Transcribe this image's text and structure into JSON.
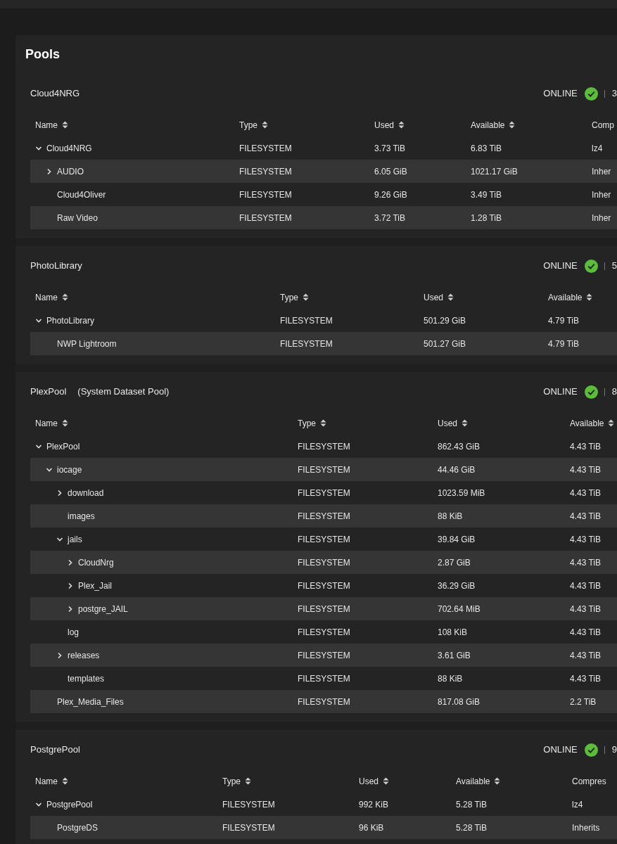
{
  "card_title": "Pools",
  "pools": [
    {
      "name": "Cloud4NRG",
      "status": "ONLINE",
      "healthy": true,
      "summary": "3",
      "columns": [
        "Name",
        "Type",
        "Used",
        "Available",
        "Comp"
      ],
      "rows": [
        {
          "kind": "branch",
          "expanded": true,
          "cells": [
            "Cloud4NRG",
            "FILESYSTEM",
            "3.73 TiB",
            "6.83 TiB",
            "lz4"
          ],
          "children": [
            {
              "kind": "branch",
              "expanded": false,
              "cells": [
                "AUDIO",
                "FILESYSTEM",
                "6.05 GiB",
                "1021.17 GiB",
                "Inher"
              ]
            },
            {
              "kind": "leaf",
              "cells": [
                "Cloud4Oliver",
                "FILESYSTEM",
                "9.26 GiB",
                "3.49 TiB",
                "Inher"
              ]
            },
            {
              "kind": "leaf",
              "cells": [
                "Raw Video",
                "FILESYSTEM",
                "3.72 TiB",
                "1.28 TiB",
                "Inher"
              ]
            }
          ]
        }
      ]
    },
    {
      "name": "PhotoLibrary",
      "status": "ONLINE",
      "healthy": true,
      "summary": "5",
      "columns": [
        "Name",
        "Type",
        "Used",
        "Available"
      ],
      "rows": [
        {
          "kind": "branch",
          "expanded": true,
          "cells": [
            "PhotoLibrary",
            "FILESYSTEM",
            "501.29 GiB",
            "4.79 TiB"
          ],
          "children": [
            {
              "kind": "leaf",
              "cells": [
                "NWP Lightroom",
                "FILESYSTEM",
                "501.27 GiB",
                "4.79 TiB"
              ]
            }
          ]
        }
      ]
    },
    {
      "name": "PlexPool",
      "note": "(System Dataset Pool)",
      "status": "ONLINE",
      "healthy": true,
      "summary": "8",
      "columns": [
        "Name",
        "Type",
        "Used",
        "Available"
      ],
      "rows": [
        {
          "kind": "branch",
          "expanded": true,
          "cells": [
            "PlexPool",
            "FILESYSTEM",
            "862.43 GiB",
            "4.43 TiB"
          ],
          "children": [
            {
              "kind": "branch",
              "expanded": true,
              "cells": [
                "iocage",
                "FILESYSTEM",
                "44.46 GiB",
                "4.43 TiB"
              ],
              "children": [
                {
                  "kind": "branch",
                  "expanded": false,
                  "cells": [
                    "download",
                    "FILESYSTEM",
                    "1023.59 MiB",
                    "4.43 TiB"
                  ]
                },
                {
                  "kind": "leaf",
                  "cells": [
                    "images",
                    "FILESYSTEM",
                    "88 KiB",
                    "4.43 TiB"
                  ]
                },
                {
                  "kind": "branch",
                  "expanded": true,
                  "cells": [
                    "jails",
                    "FILESYSTEM",
                    "39.84 GiB",
                    "4.43 TiB"
                  ],
                  "children": [
                    {
                      "kind": "branch",
                      "expanded": false,
                      "cells": [
                        "CloudNrg",
                        "FILESYSTEM",
                        "2.87 GiB",
                        "4.43 TiB"
                      ]
                    },
                    {
                      "kind": "branch",
                      "expanded": false,
                      "cells": [
                        "Plex_Jail",
                        "FILESYSTEM",
                        "36.29 GiB",
                        "4.43 TiB"
                      ]
                    },
                    {
                      "kind": "branch",
                      "expanded": false,
                      "cells": [
                        "postgre_JAIL",
                        "FILESYSTEM",
                        "702.64 MiB",
                        "4.43 TiB"
                      ]
                    }
                  ]
                },
                {
                  "kind": "leaf",
                  "cells": [
                    "log",
                    "FILESYSTEM",
                    "108 KiB",
                    "4.43 TiB"
                  ]
                },
                {
                  "kind": "branch",
                  "expanded": false,
                  "cells": [
                    "releases",
                    "FILESYSTEM",
                    "3.61 GiB",
                    "4.43 TiB"
                  ]
                },
                {
                  "kind": "leaf",
                  "cells": [
                    "templates",
                    "FILESYSTEM",
                    "88 KiB",
                    "4.43 TiB"
                  ]
                }
              ]
            },
            {
              "kind": "leaf",
              "cells": [
                "Plex_Media_Files",
                "FILESYSTEM",
                "817.08 GiB",
                "2.2 TiB"
              ]
            }
          ]
        }
      ]
    },
    {
      "name": "PostgrePool",
      "status": "ONLINE",
      "healthy": true,
      "summary": "9",
      "columns": [
        "Name",
        "Type",
        "Used",
        "Available",
        "Compres"
      ],
      "rows": [
        {
          "kind": "branch",
          "expanded": true,
          "cells": [
            "PostgrePool",
            "FILESYSTEM",
            "992 KiB",
            "5.28 TiB",
            "lz4"
          ],
          "children": [
            {
              "kind": "leaf",
              "cells": [
                "PostgreDS",
                "FILESYSTEM",
                "96 KiB",
                "5.28 TiB",
                "Inherits"
              ]
            }
          ]
        }
      ]
    }
  ]
}
